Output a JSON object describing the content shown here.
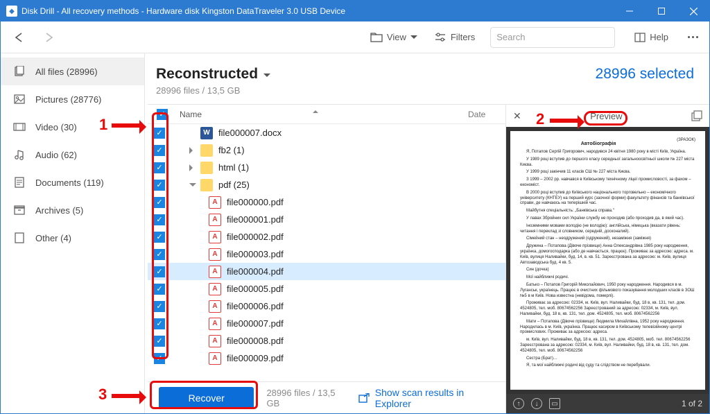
{
  "titlebar": {
    "text": "Disk Drill - All recovery methods - Hardware disk Kingston DataTraveler 3.0 USB Device"
  },
  "toolbar": {
    "view_label": "View",
    "filters_label": "Filters",
    "search_placeholder": "Search",
    "help_label": "Help"
  },
  "sidebar": {
    "items": [
      {
        "label": "All files (28996)"
      },
      {
        "label": "Pictures (28776)"
      },
      {
        "label": "Video (30)"
      },
      {
        "label": "Audio (62)"
      },
      {
        "label": "Documents (119)"
      },
      {
        "label": "Archives (5)"
      },
      {
        "label": "Other (4)"
      }
    ]
  },
  "header": {
    "title": "Reconstructed",
    "subtitle": "28996 files / 13,5 GB",
    "selected": "28996 selected"
  },
  "columns": {
    "name": "Name",
    "date": "Date"
  },
  "files": [
    {
      "type": "docx",
      "label": "file000007.docx",
      "indent": 1
    },
    {
      "type": "folder",
      "label": "fb2 (1)",
      "indent": 1,
      "expander": "right"
    },
    {
      "type": "folder",
      "label": "html (1)",
      "indent": 1,
      "expander": "right"
    },
    {
      "type": "folder",
      "label": "pdf (25)",
      "indent": 1,
      "expander": "down"
    },
    {
      "type": "pdf",
      "label": "file000000.pdf",
      "indent": 2
    },
    {
      "type": "pdf",
      "label": "file000001.pdf",
      "indent": 2
    },
    {
      "type": "pdf",
      "label": "file000002.pdf",
      "indent": 2
    },
    {
      "type": "pdf",
      "label": "file000003.pdf",
      "indent": 2
    },
    {
      "type": "pdf",
      "label": "file000004.pdf",
      "indent": 2,
      "selected": true
    },
    {
      "type": "pdf",
      "label": "file000005.pdf",
      "indent": 2
    },
    {
      "type": "pdf",
      "label": "file000006.pdf",
      "indent": 2
    },
    {
      "type": "pdf",
      "label": "file000007.pdf",
      "indent": 2
    },
    {
      "type": "pdf",
      "label": "file000008.pdf",
      "indent": 2
    },
    {
      "type": "pdf",
      "label": "file000009.pdf",
      "indent": 2
    }
  ],
  "preview": {
    "title": "Preview",
    "page_indicator": "1 of 2",
    "doc": {
      "heading": "Автобіографія",
      "sample_right": "(ЗРАЗОК)",
      "p1": "Я, Потапов Сергій Григорович, народився 24 квітня 1980 року в місті Київ, Україна.",
      "p2": "У 1989 році вступив до першого класу середньої загальноосвітньої школи № 227 міста Києва.",
      "p3": "У 1999 році закінчив 11 класів СШ № 227 міста Києва.",
      "p4": "З 1999 – 2002 рр. навчався в Київському технічному ліцеї промисловості, за фахом – економіст.",
      "p5": "В 2000 році вступив до Київського національного торговельно – економічного університету (КНТЕУ) на перший курс (заочної форми) факультету фінансів та банківської справи, де навчаюсь на теперішній час.",
      "p6": "Майбутня спеціальність: „Банківська справа.\"",
      "p7": "У лавах Збройних сил України службу не проходив (або проходив да, в який час).",
      "p8": "Іноземними мовами володію (не володію): англійська, німецька (вказати рівень: читання і переклад зі словником, середній, досконалий).",
      "p9": "Сімейний стан – неодружений (одружений), незаміжня (заміжня)",
      "p10": "Дружина – Потапова (Дівоче прізвище) Анна Олександрівна 1985 року народження, українка, домогосподарка (або де навчається, працює). Проживає за адресою: адреса. м. Київ, вулиця Наливайки, буд. 14, в. кв. 51. Зареєстрована за адресою: м. Київ, вулиця Автозаводська буд. 4 кв. 5.",
      "p11": "Син (дочка)",
      "p12": "Мої найближчі родичі.",
      "p13": "Батько – Потапов Григорій Миколайович, 1950 року народження. Народився в м. Луганськ, українець. Працює в очистних фільмового показування молодших класів в ЗОШ №5 в м Київ. Нова известна (невідома, померлі).",
      "p14": "Проживає за адресою: 02334, м. Київ, вул. Наливайки, буд. 18 в, кв. 131, тел. дом. 4524805, тел. моб. 80674562256 Зареєстрований за адресою: 02334, м. Київ, вул. Наливайки, буд. 18 в, кв. 131, тел. дом. 4524805, тел. моб. 80674562256",
      "p15": "Мати – Потапова (Дівоче прізвище) Людмила Михайлівна, 1952 року народження. Народилась в м. Київ, українка. Працює касиром в Київському телевізійному центрі промислових. Проживає за адресою: адреса.",
      "p16": "м. Київ, вул. Наливайки, буд. 18 в, кв. 131, тел. дом. 4524805, моб. тел. 80674562256 Зареєстрована за адресою: 02334, м. Київ, вул. Наливайки, буд. 18 в, кв. 131, тел. дом. 4524805, тел. моб. 80674562256",
      "p17": "Сестра (Брат)...",
      "p18": "Я, та мої найближчі родичі від суду та слідством не перебували."
    }
  },
  "bottom": {
    "recover_label": "Recover",
    "summary": "28996 files / 13,5 GB",
    "show_in_explorer": "Show scan results in Explorer"
  },
  "annotations": {
    "n1": "1",
    "n2": "2",
    "n3": "3"
  }
}
